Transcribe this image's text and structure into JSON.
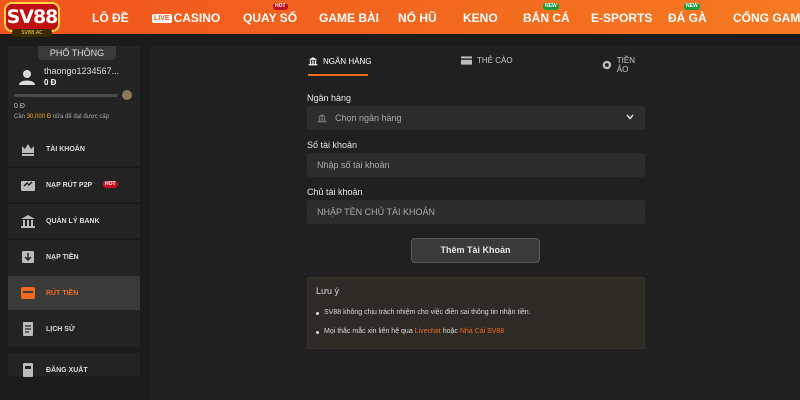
{
  "logo": {
    "text": "SV88",
    "subtext": "SV88.AC"
  },
  "nav": {
    "items": [
      {
        "label": "LÔ ĐỀ",
        "tag": ""
      },
      {
        "label": "CASINO",
        "live": "LIVE",
        "tag": ""
      },
      {
        "label": "QUAY SỐ",
        "tag": "HOT"
      },
      {
        "label": "GAME BÀI",
        "tag": ""
      },
      {
        "label": "NỔ HŨ",
        "tag": ""
      },
      {
        "label": "KENO",
        "tag": ""
      },
      {
        "label": "BẮN CÁ",
        "tag": "NEW"
      },
      {
        "label": "E-SPORTS",
        "tag": ""
      },
      {
        "label": "ĐÁ GÀ",
        "tag": "NEW"
      },
      {
        "label": "CỔNG GAMES",
        "tag": ""
      }
    ]
  },
  "profile": {
    "rank": "PHỔ THÔNG",
    "username": "thaongo1234567...",
    "balance": "0 Đ",
    "progress_value": "0 Đ",
    "progress_fraction": 0,
    "note_prefix": "Cần ",
    "note_amount": "30,000 Đ",
    "note_suffix": " nữa để đạt được cấp"
  },
  "menu": {
    "items": [
      {
        "label": "TÀI KHOẢN",
        "icon": "crown-icon"
      },
      {
        "label": "NẠP RÚT P2P",
        "icon": "exchange-icon",
        "tag": "HOT"
      },
      {
        "label": "QUẢN LÝ BANK",
        "icon": "bank-icon"
      },
      {
        "label": "NẠP TIỀN",
        "icon": "deposit-icon"
      },
      {
        "label": "RÚT TIỀN",
        "icon": "withdraw-icon",
        "active": true
      },
      {
        "label": "LỊCH SỬ",
        "icon": "history-icon"
      },
      {
        "label": "ĐĂNG XUẤT",
        "icon": "logout-icon"
      }
    ]
  },
  "tabs": [
    {
      "label": "NGÂN HÀNG",
      "icon": "bank-icon",
      "active": true
    },
    {
      "label": "THẺ CÀO",
      "icon": "card-icon"
    },
    {
      "label": "TIỀN ẢO",
      "icon": "coin-icon"
    }
  ],
  "form": {
    "bank_label": "Ngân hàng",
    "bank_placeholder": "Chọn ngân hàng",
    "account_label": "Số tài khoản",
    "account_placeholder": "Nhập số tài khoản",
    "owner_label": "Chủ tài khoản",
    "owner_placeholder": "NHẬP TÊN CHỦ TÀI KHOẢN",
    "submit_label": "Thêm Tài Khoản"
  },
  "note": {
    "title": "Lưu ý",
    "line1": "SV88 không chịu trách nhiệm cho việc điền sai thông tin nhận tiền.",
    "line2_prefix": "Mọi thắc mắc xin liên hệ qua ",
    "line2_link1": "Livechat",
    "line2_mid": " hoặc ",
    "line2_link2": "Nhà Cái SV88"
  },
  "colors": {
    "accent": "#f26a1e",
    "hot": "#c1121f",
    "new": "#1e9e3a"
  }
}
